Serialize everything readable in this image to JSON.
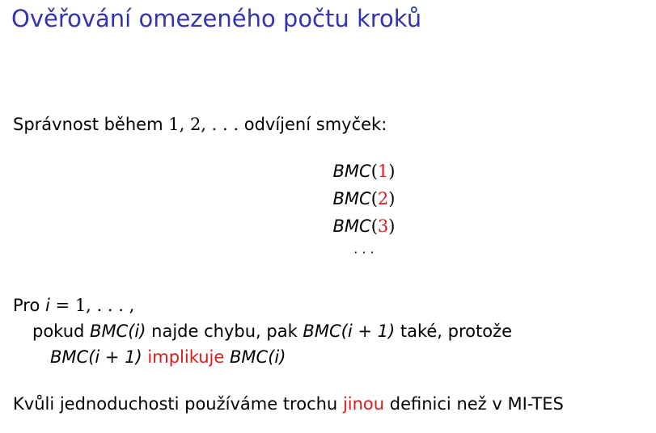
{
  "title": "Ověřování omezeného počtu kroků",
  "intro": {
    "text": "Správnost během",
    "math": "1, 2, . . .",
    "tail": "odvíjení smyček:"
  },
  "bmc_list": [
    {
      "name": "BMC",
      "open": "(",
      "arg": "1",
      "close": ")"
    },
    {
      "name": "BMC",
      "open": "(",
      "arg": "2",
      "close": ")"
    },
    {
      "name": "BMC",
      "open": "(",
      "arg": "3",
      "close": ")"
    }
  ],
  "vdots": "· · ·",
  "loop": {
    "pro": "Pro",
    "var": "i",
    "eq": "= 1, . . . ,"
  },
  "cond": {
    "prefix": "pokud",
    "bmc_i": "BMC",
    "arg_i": "(i)",
    "mid": "najde chybu, pak",
    "bmc_next": "BMC",
    "arg_next": "(i + 1)",
    "suffix": "také, protože"
  },
  "impl": {
    "bmc_next": "BMC",
    "arg_next": "(i + 1)",
    "word": "implikuje",
    "bmc_i": "BMC",
    "arg_i": "(i)"
  },
  "footer": {
    "prefix": "Kvůli jednoduchosti používáme trochu",
    "highlight": "jinou",
    "suffix": "definici než v MI-TES"
  },
  "colors": {
    "title": "#3333b3",
    "highlight": "#e01a1a"
  }
}
